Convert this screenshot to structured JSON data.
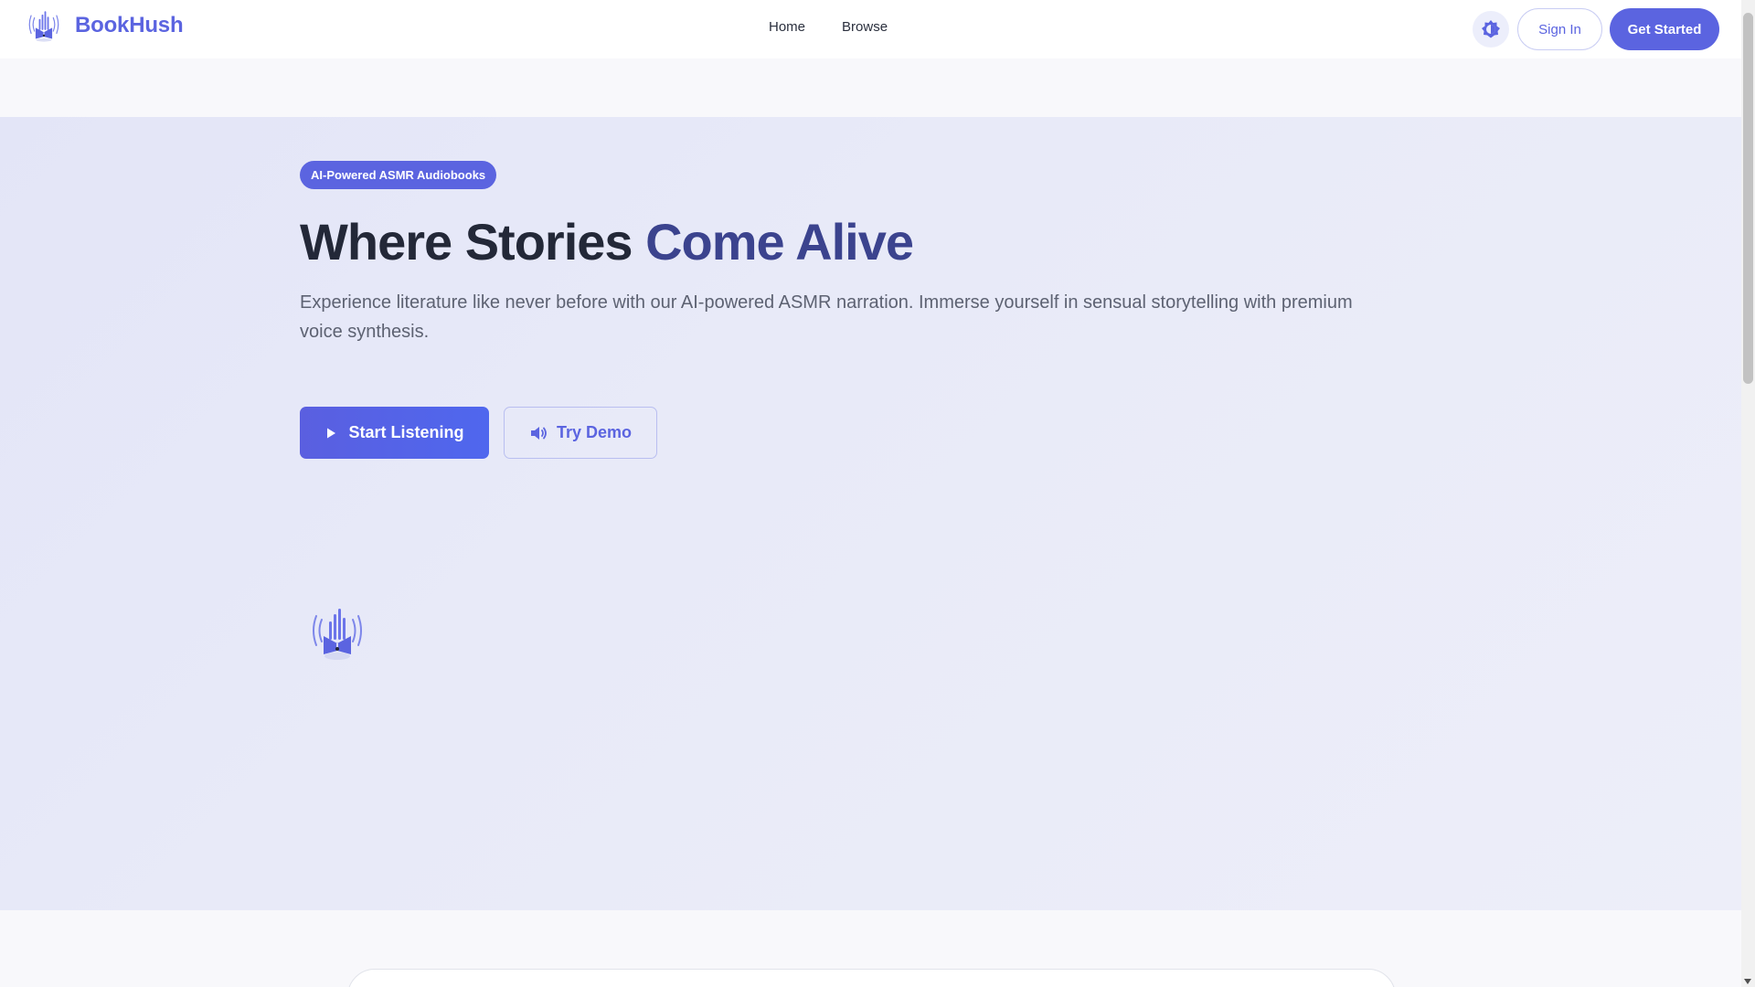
{
  "header": {
    "brand_name": "BookHush",
    "nav": [
      {
        "label": "Home"
      },
      {
        "label": "Browse"
      }
    ],
    "sign_in_label": "Sign In",
    "get_started_label": "Get Started"
  },
  "hero": {
    "badge": "AI-Powered ASMR Audiobooks",
    "title_part1": "Where Stories ",
    "title_part2": "Come Alive",
    "subtitle": "Experience literature like never before with our AI-powered ASMR narration. Immerse yourself in sensual storytelling with premium voice synthesis.",
    "primary_cta": "Start Listening",
    "secondary_cta": "Try Demo"
  },
  "icons": {
    "logo": "book-soundwave-icon",
    "theme": "theme-toggle-icon",
    "play": "play-icon",
    "speaker": "speaker-icon"
  },
  "colors": {
    "brand": "#5b64e0",
    "title_dark": "#232838",
    "title_accent": "#3b438e",
    "hero_bg": "#e6e8f8"
  }
}
